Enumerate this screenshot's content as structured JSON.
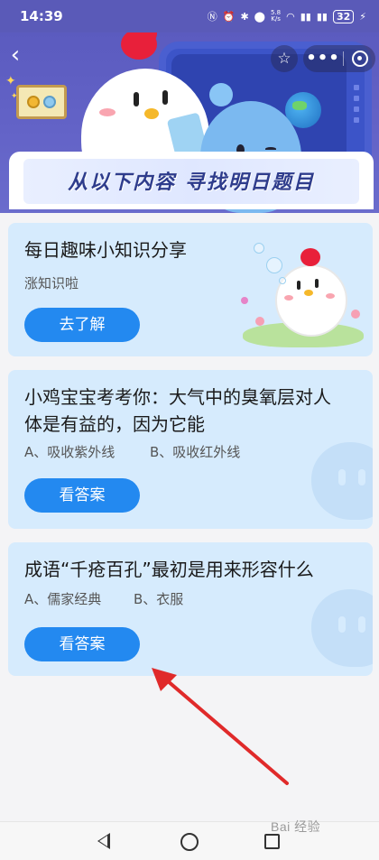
{
  "status_bar": {
    "time": "14:39",
    "net_speed_value": "5.8",
    "net_speed_unit": "K/s",
    "battery": "32"
  },
  "banner": {
    "title": "从以下内容  寻找明日题目"
  },
  "cards": [
    {
      "title": "每日趣味小知识分享",
      "subtitle": "涨知识啦",
      "button": "去了解"
    },
    {
      "title_line1": "小鸡宝宝考考你：大气中的臭氧层对人",
      "title_line2": "体是有益的，因为它能",
      "option_a": "A、吸收紫外线",
      "option_b": "B、吸收红外线",
      "button": "看答案"
    },
    {
      "title": "成语“千疮百孔”最初是用来形容什么",
      "option_a": "A、儒家经典",
      "option_b": "B、衣服",
      "button": "看答案"
    }
  ],
  "annotation": {
    "arrow_color": "#e02a2a"
  },
  "watermark": "Bai 经验",
  "colors": {
    "banner": "#5b5bbf",
    "card_bg": "#d6ebfd",
    "button": "#2389f0",
    "title_text": "#2e3c8c"
  }
}
